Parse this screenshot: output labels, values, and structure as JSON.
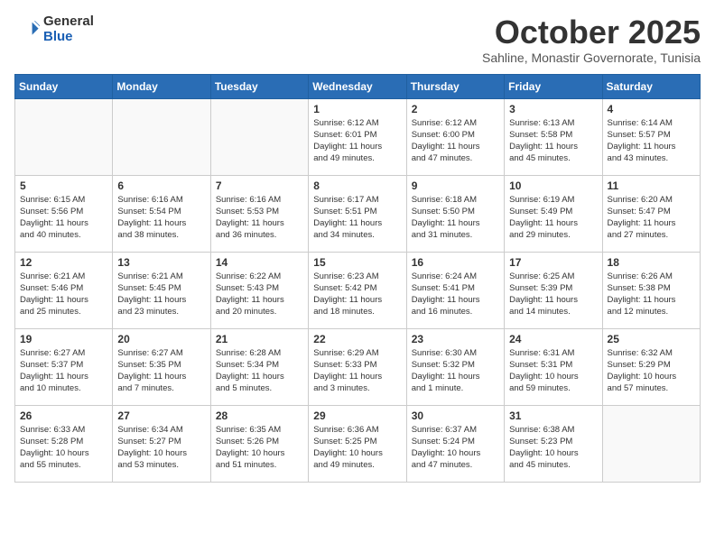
{
  "header": {
    "logo_general": "General",
    "logo_blue": "Blue",
    "title": "October 2025",
    "subtitle": "Sahline, Monastir Governorate, Tunisia"
  },
  "weekdays": [
    "Sunday",
    "Monday",
    "Tuesday",
    "Wednesday",
    "Thursday",
    "Friday",
    "Saturday"
  ],
  "weeks": [
    [
      {
        "day": "",
        "info": ""
      },
      {
        "day": "",
        "info": ""
      },
      {
        "day": "",
        "info": ""
      },
      {
        "day": "1",
        "info": "Sunrise: 6:12 AM\nSunset: 6:01 PM\nDaylight: 11 hours\nand 49 minutes."
      },
      {
        "day": "2",
        "info": "Sunrise: 6:12 AM\nSunset: 6:00 PM\nDaylight: 11 hours\nand 47 minutes."
      },
      {
        "day": "3",
        "info": "Sunrise: 6:13 AM\nSunset: 5:58 PM\nDaylight: 11 hours\nand 45 minutes."
      },
      {
        "day": "4",
        "info": "Sunrise: 6:14 AM\nSunset: 5:57 PM\nDaylight: 11 hours\nand 43 minutes."
      }
    ],
    [
      {
        "day": "5",
        "info": "Sunrise: 6:15 AM\nSunset: 5:56 PM\nDaylight: 11 hours\nand 40 minutes."
      },
      {
        "day": "6",
        "info": "Sunrise: 6:16 AM\nSunset: 5:54 PM\nDaylight: 11 hours\nand 38 minutes."
      },
      {
        "day": "7",
        "info": "Sunrise: 6:16 AM\nSunset: 5:53 PM\nDaylight: 11 hours\nand 36 minutes."
      },
      {
        "day": "8",
        "info": "Sunrise: 6:17 AM\nSunset: 5:51 PM\nDaylight: 11 hours\nand 34 minutes."
      },
      {
        "day": "9",
        "info": "Sunrise: 6:18 AM\nSunset: 5:50 PM\nDaylight: 11 hours\nand 31 minutes."
      },
      {
        "day": "10",
        "info": "Sunrise: 6:19 AM\nSunset: 5:49 PM\nDaylight: 11 hours\nand 29 minutes."
      },
      {
        "day": "11",
        "info": "Sunrise: 6:20 AM\nSunset: 5:47 PM\nDaylight: 11 hours\nand 27 minutes."
      }
    ],
    [
      {
        "day": "12",
        "info": "Sunrise: 6:21 AM\nSunset: 5:46 PM\nDaylight: 11 hours\nand 25 minutes."
      },
      {
        "day": "13",
        "info": "Sunrise: 6:21 AM\nSunset: 5:45 PM\nDaylight: 11 hours\nand 23 minutes."
      },
      {
        "day": "14",
        "info": "Sunrise: 6:22 AM\nSunset: 5:43 PM\nDaylight: 11 hours\nand 20 minutes."
      },
      {
        "day": "15",
        "info": "Sunrise: 6:23 AM\nSunset: 5:42 PM\nDaylight: 11 hours\nand 18 minutes."
      },
      {
        "day": "16",
        "info": "Sunrise: 6:24 AM\nSunset: 5:41 PM\nDaylight: 11 hours\nand 16 minutes."
      },
      {
        "day": "17",
        "info": "Sunrise: 6:25 AM\nSunset: 5:39 PM\nDaylight: 11 hours\nand 14 minutes."
      },
      {
        "day": "18",
        "info": "Sunrise: 6:26 AM\nSunset: 5:38 PM\nDaylight: 11 hours\nand 12 minutes."
      }
    ],
    [
      {
        "day": "19",
        "info": "Sunrise: 6:27 AM\nSunset: 5:37 PM\nDaylight: 11 hours\nand 10 minutes."
      },
      {
        "day": "20",
        "info": "Sunrise: 6:27 AM\nSunset: 5:35 PM\nDaylight: 11 hours\nand 7 minutes."
      },
      {
        "day": "21",
        "info": "Sunrise: 6:28 AM\nSunset: 5:34 PM\nDaylight: 11 hours\nand 5 minutes."
      },
      {
        "day": "22",
        "info": "Sunrise: 6:29 AM\nSunset: 5:33 PM\nDaylight: 11 hours\nand 3 minutes."
      },
      {
        "day": "23",
        "info": "Sunrise: 6:30 AM\nSunset: 5:32 PM\nDaylight: 11 hours\nand 1 minute."
      },
      {
        "day": "24",
        "info": "Sunrise: 6:31 AM\nSunset: 5:31 PM\nDaylight: 10 hours\nand 59 minutes."
      },
      {
        "day": "25",
        "info": "Sunrise: 6:32 AM\nSunset: 5:29 PM\nDaylight: 10 hours\nand 57 minutes."
      }
    ],
    [
      {
        "day": "26",
        "info": "Sunrise: 6:33 AM\nSunset: 5:28 PM\nDaylight: 10 hours\nand 55 minutes."
      },
      {
        "day": "27",
        "info": "Sunrise: 6:34 AM\nSunset: 5:27 PM\nDaylight: 10 hours\nand 53 minutes."
      },
      {
        "day": "28",
        "info": "Sunrise: 6:35 AM\nSunset: 5:26 PM\nDaylight: 10 hours\nand 51 minutes."
      },
      {
        "day": "29",
        "info": "Sunrise: 6:36 AM\nSunset: 5:25 PM\nDaylight: 10 hours\nand 49 minutes."
      },
      {
        "day": "30",
        "info": "Sunrise: 6:37 AM\nSunset: 5:24 PM\nDaylight: 10 hours\nand 47 minutes."
      },
      {
        "day": "31",
        "info": "Sunrise: 6:38 AM\nSunset: 5:23 PM\nDaylight: 10 hours\nand 45 minutes."
      },
      {
        "day": "",
        "info": ""
      }
    ]
  ]
}
